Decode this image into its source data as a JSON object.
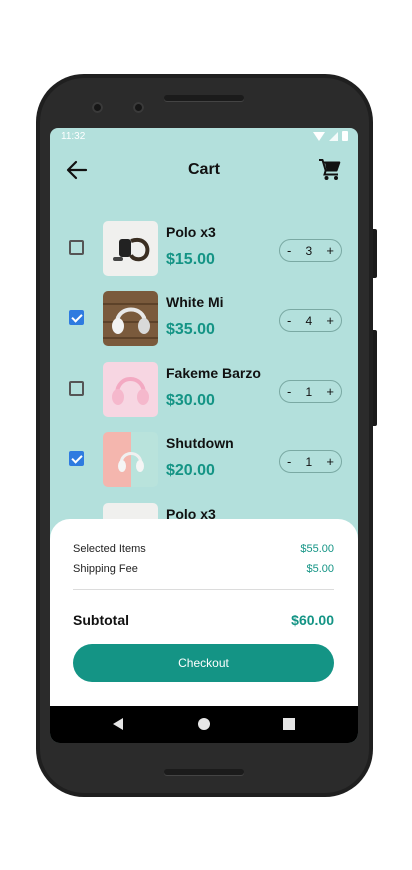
{
  "status": {
    "time": "11:32"
  },
  "header": {
    "title": "Cart"
  },
  "items": [
    {
      "name": "Polo x3",
      "price": "$15.00",
      "qty": "3",
      "checked": false
    },
    {
      "name": "White Mi",
      "price": "$35.00",
      "qty": "4",
      "checked": true
    },
    {
      "name": "Fakeme Barzo",
      "price": "$30.00",
      "qty": "1",
      "checked": false
    },
    {
      "name": "Shutdown",
      "price": "$20.00",
      "qty": "1",
      "checked": true
    },
    {
      "name": "Polo x3"
    }
  ],
  "qty_controls": {
    "minus": "-",
    "plus": "+"
  },
  "summary": {
    "selected_label": "Selected Items",
    "selected_value": "$55.00",
    "shipping_label": "Shipping Fee",
    "shipping_value": "$5.00",
    "subtotal_label": "Subtotal",
    "subtotal_value": "$60.00",
    "checkout_label": "Checkout"
  },
  "colors": {
    "screen_bg": "#b3e0dc",
    "accent": "#149485",
    "checkbox": "#2e7be0"
  },
  "icons": [
    "back-arrow-icon",
    "cart-icon",
    "wifi-icon",
    "signal-icon",
    "battery-icon",
    "nav-back-icon",
    "nav-home-icon",
    "nav-recent-icon"
  ]
}
